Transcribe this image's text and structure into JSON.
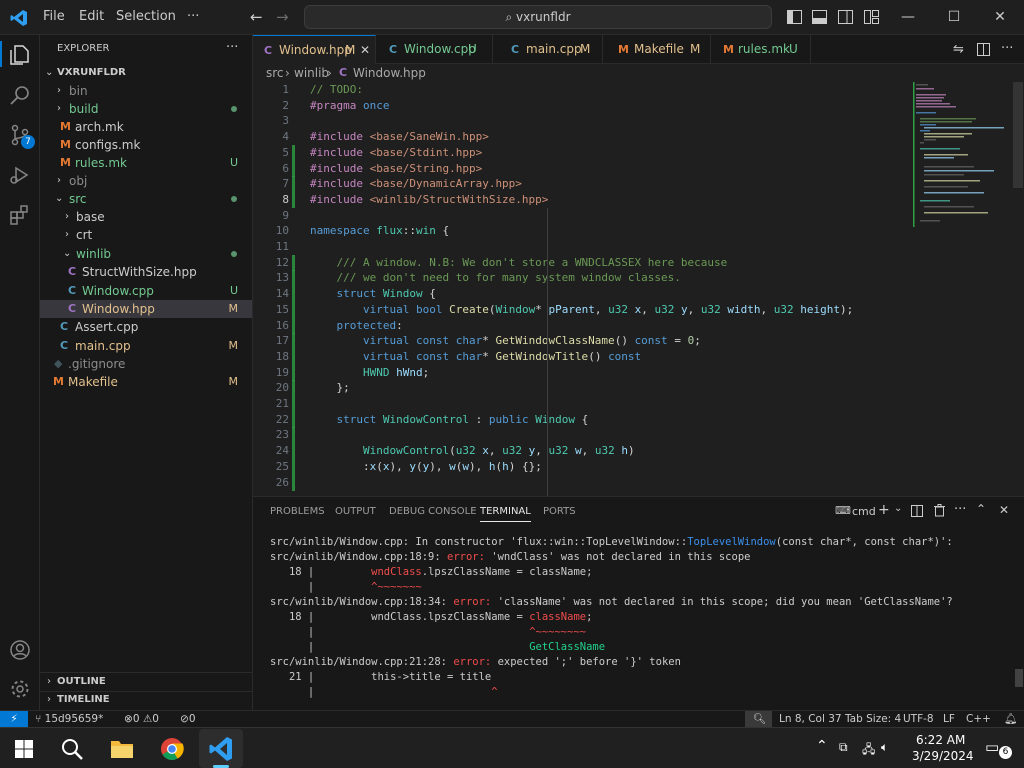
{
  "titlebar": {
    "menu": [
      "File",
      "Edit",
      "Selection",
      "···"
    ],
    "search": "vxrunfldr"
  },
  "sidebar": {
    "title": "EXPLORER",
    "more": "···",
    "root": "VXRUNFLDR",
    "items": [
      {
        "label": "bin",
        "badge": ""
      },
      {
        "label": "build",
        "badge": ""
      },
      {
        "label": "arch.mk",
        "badge": ""
      },
      {
        "label": "configs.mk",
        "badge": ""
      },
      {
        "label": "rules.mk",
        "badge": "U"
      },
      {
        "label": "obj",
        "badge": ""
      },
      {
        "label": "src",
        "badge": ""
      },
      {
        "label": "base",
        "badge": ""
      },
      {
        "label": "crt",
        "badge": ""
      },
      {
        "label": "winlib",
        "badge": ""
      },
      {
        "label": "StructWithSize.hpp",
        "badge": ""
      },
      {
        "label": "Window.cpp",
        "badge": "U"
      },
      {
        "label": "Window.hpp",
        "badge": "M"
      },
      {
        "label": "Assert.cpp",
        "badge": ""
      },
      {
        "label": "main.cpp",
        "badge": "M"
      },
      {
        "label": ".gitignore",
        "badge": ""
      },
      {
        "label": "Makefile",
        "badge": "M"
      }
    ],
    "outline": "OUTLINE",
    "timeline": "TIMELINE"
  },
  "tabs": [
    {
      "label": "Window.hpp",
      "status": "M"
    },
    {
      "label": "Window.cpp",
      "status": "U"
    },
    {
      "label": "main.cpp",
      "status": "M"
    },
    {
      "label": "Makefile",
      "status": "M"
    },
    {
      "label": "rules.mk",
      "status": "U"
    }
  ],
  "breadcrumb": [
    "src",
    "winlib",
    "Window.hpp"
  ],
  "editor": {
    "lines": [
      "// TODO:",
      "#pragma once",
      "",
      "#include <base/SaneWin.hpp>",
      "#include <base/Stdint.hpp>",
      "#include <base/String.hpp>",
      "#include <base/DynamicArray.hpp>",
      "#include <winlib/StructWithSize.hpp>",
      "",
      "namespace flux::win {",
      "",
      "    /// A window. N.B: We don't store a WNDCLASSEX here because",
      "    /// we don't need to for many system window classes.",
      "    struct Window {",
      "        virtual bool Create(Window* pParent, u32 x, u32 y, u32 width, u32 height);",
      "    protected:",
      "        virtual const char* GetWindowClassName() const = 0;",
      "        virtual const char* GetWindowTitle() const",
      "        HWND hWnd;",
      "    };",
      "",
      "    struct WindowControl : public Window {",
      "",
      "        WindowControl(u32 x, u32 y, u32 w, u32 h)",
      "        :x(x), y(y), w(w), h(h) {};",
      ""
    ]
  },
  "panel": {
    "tabs": [
      "PROBLEMS",
      "OUTPUT",
      "DEBUG CONSOLE",
      "TERMINAL",
      "PORTS"
    ],
    "shell": "cmd",
    "terminal": [
      "src/winlib/Window.cpp: In constructor 'flux::win::TopLevelWindow::TopLevelWindow(const char*, const char*)':",
      "src/winlib/Window.cpp:18:9: error: 'wndClass' was not declared in this scope",
      "   18 |         wndClass.lpszClassName = className;",
      "      |         ^~~~~~~~",
      "src/winlib/Window.cpp:18:34: error: 'className' was not declared in this scope; did you mean 'GetClassName'?",
      "   18 |         wndClass.lpszClassName = className;",
      "      |                                  ^~~~~~~~~",
      "      |                                  GetClassName",
      "src/winlib/Window.cpp:21:28: error: expected ';' before '}' token",
      "   21 |         this->title = title",
      "      |                            ^"
    ]
  },
  "statusbar": {
    "branch": "15d95659*",
    "errors": "0",
    "warnings": "0",
    "ports": "0",
    "position": "Ln 8, Col 37",
    "tabsize": "Tab Size: 4",
    "encoding": "UTF-8",
    "eol": "LF",
    "language": "C++"
  },
  "taskbar": {
    "time": "6:22 AM",
    "date": "3/29/2024",
    "notifications": "6"
  },
  "colors": {
    "accent": "#0078d4",
    "git_modified": "#e2c08d",
    "git_untracked": "#73c991",
    "error": "#f14c4c"
  }
}
